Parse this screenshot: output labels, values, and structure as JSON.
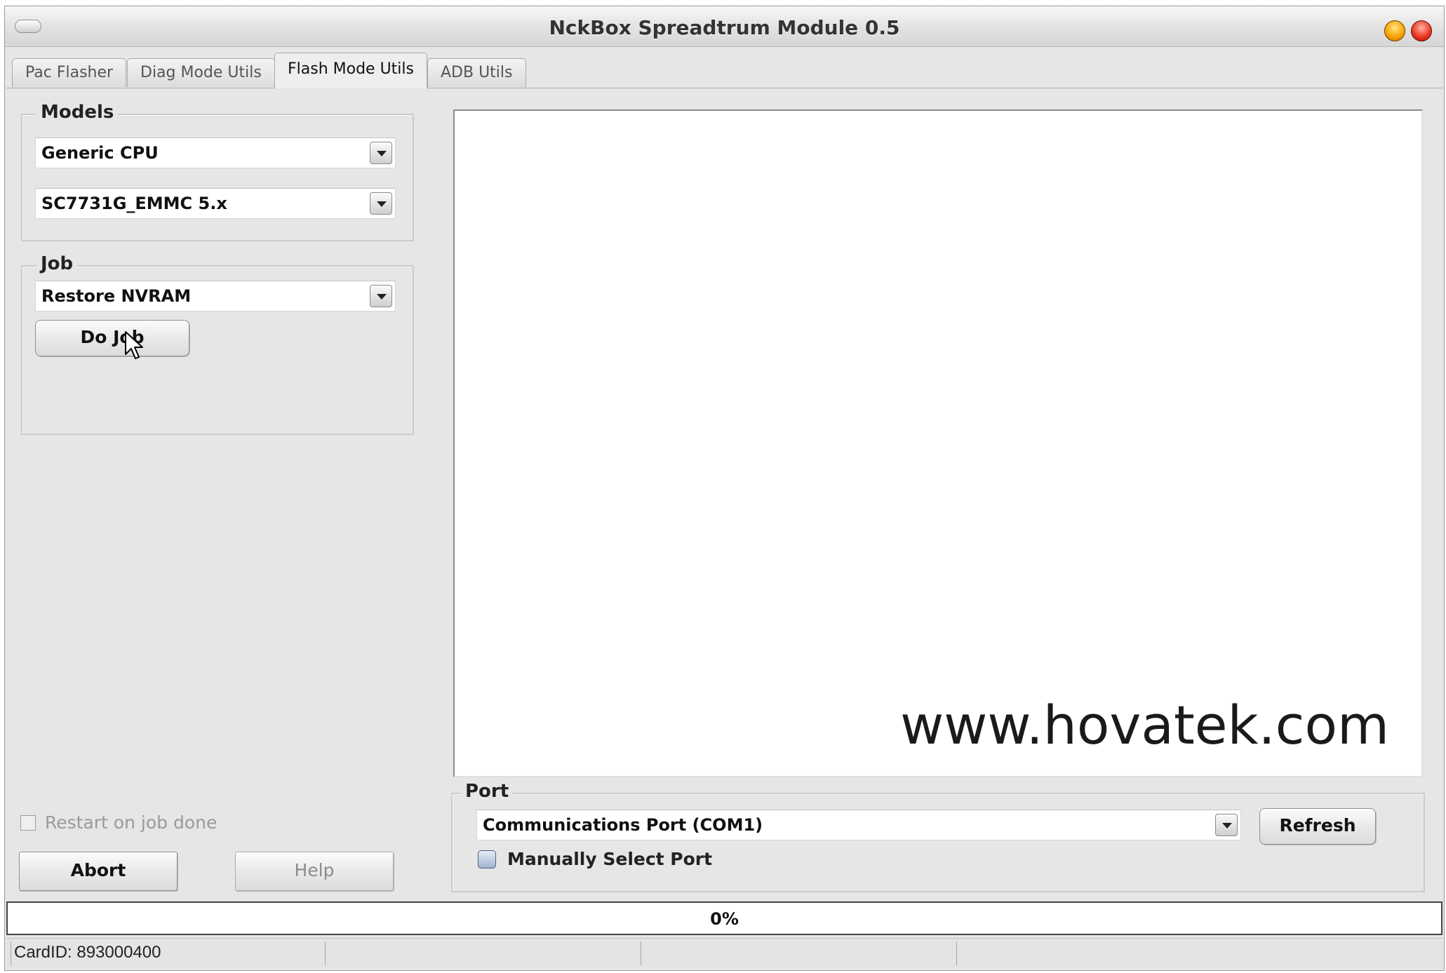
{
  "window": {
    "title": "NckBox Spreadtrum Module 0.5"
  },
  "tabs": [
    {
      "label": "Pac Flasher",
      "active": false
    },
    {
      "label": "Diag Mode Utils",
      "active": false
    },
    {
      "label": "Flash Mode Utils",
      "active": true
    },
    {
      "label": "ADB Utils",
      "active": false
    }
  ],
  "models": {
    "label": "Models",
    "cpu_value": "Generic CPU",
    "chip_value": "SC7731G_EMMC  5.x"
  },
  "job": {
    "label": "Job",
    "value": "Restore NVRAM",
    "button_label": "Do Job"
  },
  "log": {
    "watermark": "www.hovatek.com"
  },
  "options": {
    "restart_on_done_label": "Restart on job done",
    "restart_on_done_checked": false
  },
  "actions": {
    "abort_label": "Abort",
    "help_label": "Help"
  },
  "port": {
    "label": "Port",
    "value": "Communications Port (COM1)",
    "refresh_label": "Refresh",
    "manual_label": "Manually Select Port",
    "manual_checked": false
  },
  "progress": {
    "value": 0,
    "text": "0%",
    "fill_color": "#3a7bd5"
  },
  "status": {
    "card_id": "CardID: 893000400"
  }
}
